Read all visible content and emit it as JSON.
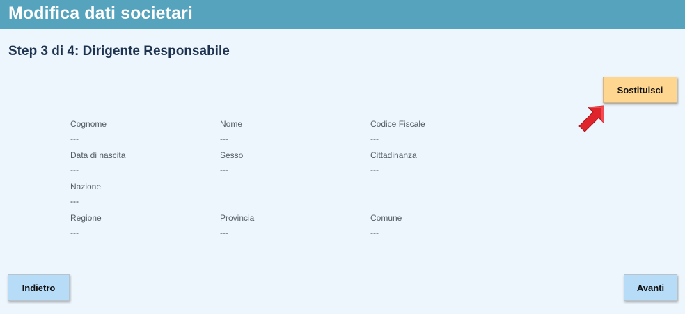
{
  "header": {
    "title": "Modifica dati societari"
  },
  "step": {
    "title": "Step 3 di 4: Dirigente Responsabile"
  },
  "buttons": {
    "replace_label": "Sostituisci",
    "back_label": "Indietro",
    "next_label": "Avanti"
  },
  "fields": {
    "cognome": {
      "label": "Cognome",
      "value": "---"
    },
    "nome": {
      "label": "Nome",
      "value": "---"
    },
    "codice_fiscale": {
      "label": "Codice Fiscale",
      "value": "---"
    },
    "data_nascita": {
      "label": "Data di nascita",
      "value": "---"
    },
    "sesso": {
      "label": "Sesso",
      "value": "---"
    },
    "cittadinanza": {
      "label": "Cittadinanza",
      "value": "---"
    },
    "nazione": {
      "label": "Nazione",
      "value": "---"
    },
    "regione": {
      "label": "Regione",
      "value": "---"
    },
    "provincia": {
      "label": "Provincia",
      "value": "---"
    },
    "comune": {
      "label": "Comune",
      "value": "---"
    }
  },
  "colors": {
    "header_bg": "#56a3bd",
    "page_bg": "#eef6fd",
    "replace_button_bg": "#ffd68f",
    "nav_button_bg": "#b7dcf7",
    "arrow": "#e0242c"
  },
  "icons": {
    "pointer": "red-arrow-icon"
  }
}
